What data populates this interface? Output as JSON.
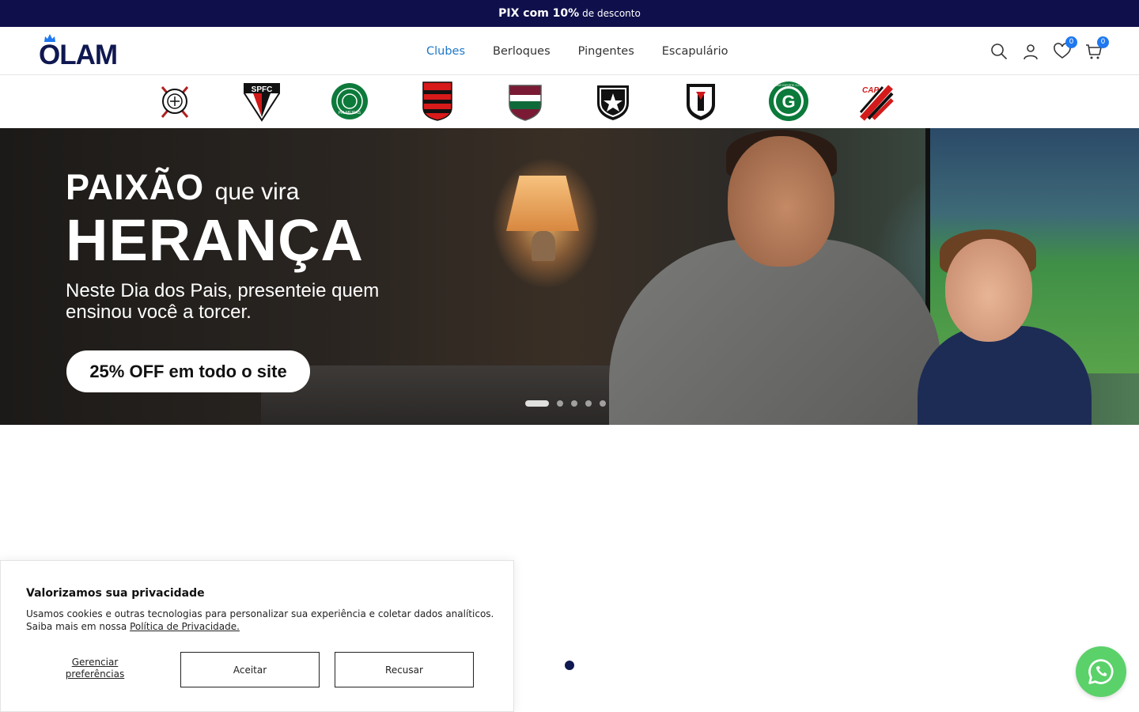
{
  "announcement": {
    "bold": "PIX com 10%",
    "rest": "de desconto"
  },
  "brand": {
    "logo_text": "OLAM"
  },
  "nav": {
    "items": [
      {
        "label": "Clubes",
        "active": true
      },
      {
        "label": "Berloques",
        "active": false
      },
      {
        "label": "Pingentes",
        "active": false
      },
      {
        "label": "Escapulário",
        "active": false
      }
    ]
  },
  "header_icons": {
    "wishlist_count": "0",
    "cart_count": "0"
  },
  "clubs": {
    "crest_texts": {
      "spfc": "SPFC",
      "cap": "CAP",
      "goias": "GOIÁS ESPORTE CLUBE",
      "palmeiras": "PALMEIRAS"
    },
    "items": [
      {
        "name": "corinthians-crest-icon"
      },
      {
        "name": "sao-paulo-crest-icon"
      },
      {
        "name": "palmeiras-crest-icon"
      },
      {
        "name": "flamengo-crest-icon"
      },
      {
        "name": "fluminense-crest-icon"
      },
      {
        "name": "botafogo-crest-icon"
      },
      {
        "name": "vasco-crest-icon"
      },
      {
        "name": "goias-crest-icon"
      },
      {
        "name": "athletico-crest-icon"
      }
    ]
  },
  "hero": {
    "title_bold": "PAIXÃO",
    "title_light": "que vira",
    "title_big": "HERANÇA",
    "subtitle": "Neste Dia dos Pais, presenteie quem ensinou você a torcer.",
    "cta": "25% OFF em todo o site",
    "slides_total": 5,
    "slide_active": 1
  },
  "cookie": {
    "title": "Valorizamos sua privacidade",
    "text": "Usamos cookies e outras tecnologias para personalizar sua experiência e coletar dados analíticos. Saiba mais em nossa",
    "link": "Política de Privacidade.",
    "manage": "Gerenciar preferências",
    "accept": "Aceitar",
    "decline": "Recusar"
  },
  "colors": {
    "navy": "#0f0f4b",
    "accent_blue": "#1e78c8",
    "whatsapp_green": "#5bd16a"
  }
}
